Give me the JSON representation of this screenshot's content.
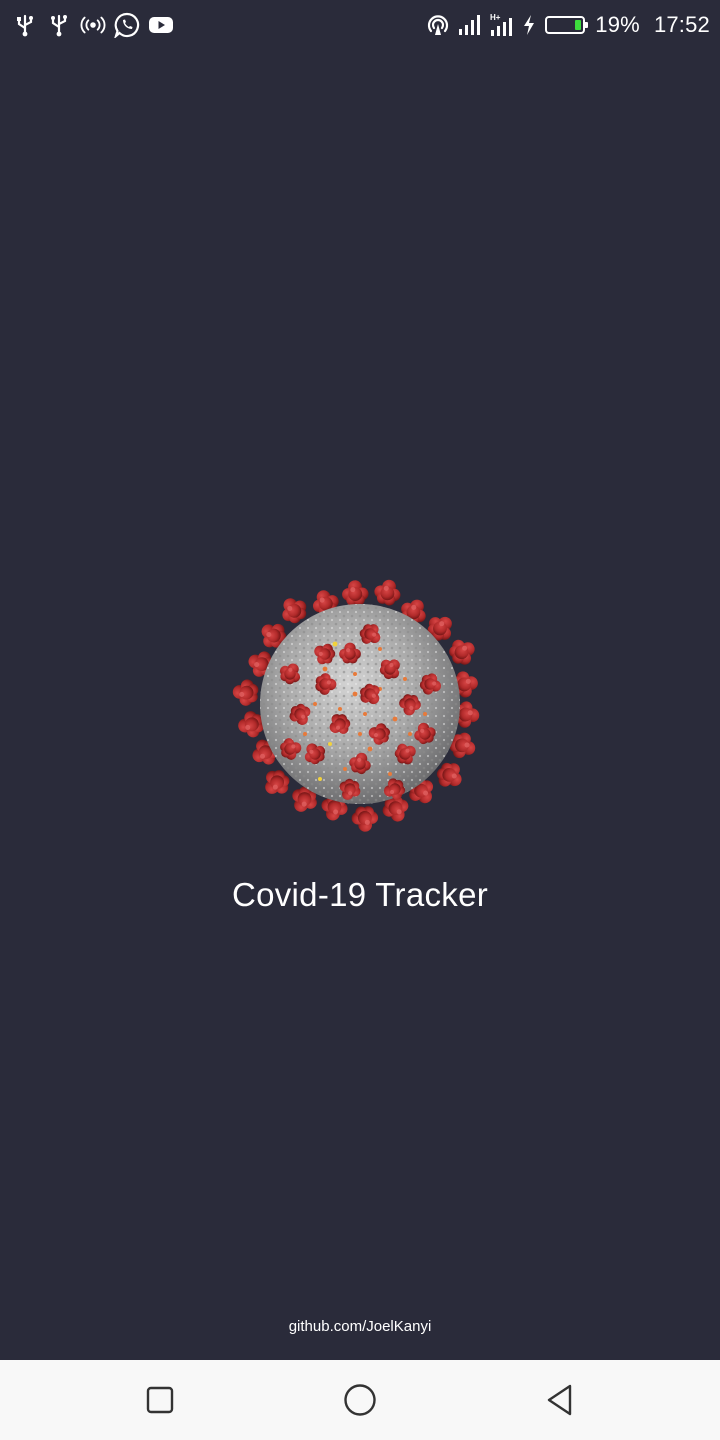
{
  "status_bar": {
    "left_icons": [
      "usb-icon",
      "usb-icon",
      "hotspot-icon",
      "whatsapp-icon",
      "youtube-icon"
    ],
    "right_icons": [
      "wifi-hotspot-icon",
      "signal-icon",
      "signal-hplus-icon",
      "charging-icon",
      "battery-icon"
    ],
    "network_type": "H+",
    "battery_level": 0.19,
    "battery_fill_color": "#3ddc3d",
    "battery_percent": "19%",
    "time": "17:52"
  },
  "splash": {
    "logo_icon": "coronavirus-icon",
    "title": "Covid-19 Tracker",
    "credit": "github.com/JoelKanyi"
  },
  "nav_bar": {
    "buttons": [
      "recents-icon",
      "home-icon",
      "back-icon"
    ]
  },
  "colors": {
    "background": "#2a2b3a",
    "nav_background": "#f8f8f8",
    "virus_body": "#a8a8a8",
    "virus_spike": "#b22a2a"
  }
}
